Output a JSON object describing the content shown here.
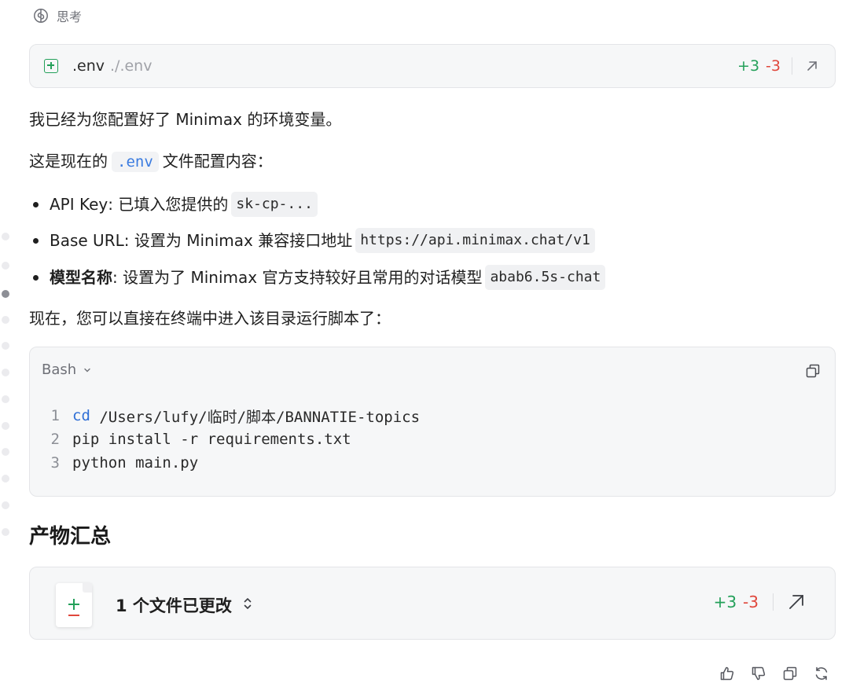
{
  "thinking": {
    "label": "思考",
    "icon": "brain-icon"
  },
  "file_change": {
    "icon": "add-file-icon",
    "filename": ".env",
    "path": "./.env",
    "additions": "+3",
    "deletions": "-3",
    "open_icon": "arrow-up-right-icon"
  },
  "message": {
    "intro": "我已经为您配置好了 Minimax 的环境变量。",
    "config_prefix": "这是现在的",
    "config_code": ".env",
    "config_suffix": "文件配置内容：",
    "bullets": [
      {
        "key": "API Key",
        "sep": ": ",
        "text": "已填入您提供的",
        "code": "sk-cp-..."
      },
      {
        "key": "Base URL",
        "sep": ": ",
        "text": "设置为 Minimax 兼容接口地址",
        "code": "https://api.minimax.chat/v1"
      },
      {
        "key": "模型名称",
        "sep": ": ",
        "text": "设置为了 Minimax 官方支持较好且常用的对话模型",
        "code": "abab6.5s-chat"
      }
    ],
    "run_hint": "现在，您可以直接在终端中进入该目录运行脚本了："
  },
  "code_block": {
    "language": "Bash",
    "lines": [
      {
        "num": "1",
        "kw": "cd",
        "rest": " /Users/lufy/临时/脚本/BANNATIE-topics"
      },
      {
        "num": "2",
        "kw": "",
        "rest": "pip install -r requirements.txt"
      },
      {
        "num": "3",
        "kw": "",
        "rest": "python main.py"
      }
    ]
  },
  "summary": {
    "heading": "产物汇总",
    "title": "1 个文件已更改",
    "additions": "+3",
    "deletions": "-3"
  },
  "feedback": {
    "icons": [
      "thumbs-up-icon",
      "thumbs-down-icon",
      "copy-icon",
      "regenerate-icon"
    ]
  },
  "colors": {
    "addition": "#24a05a",
    "deletion": "#e0473c",
    "inline_code_accent": "#3a7be0",
    "card_background": "#f6f7f8"
  }
}
